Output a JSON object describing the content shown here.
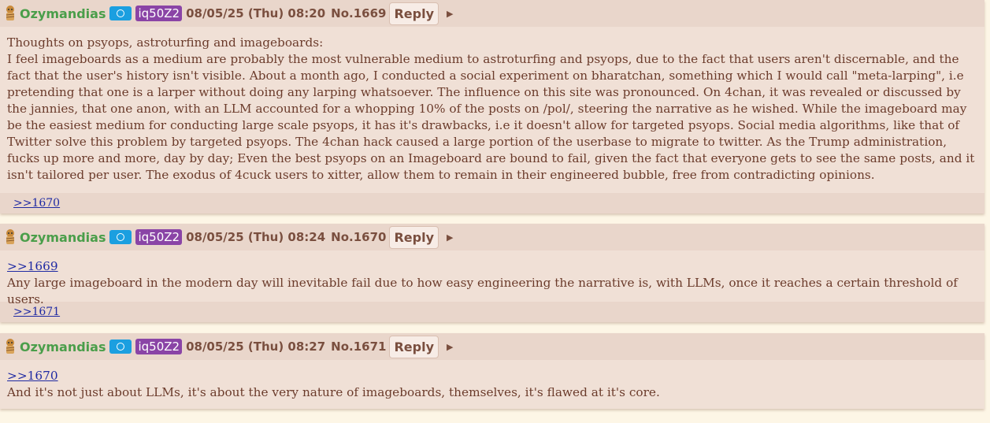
{
  "posts": [
    {
      "name": "Ozymandias",
      "id": "iq50Z2",
      "date": "08/05/25 (Thu) 08:20",
      "number": "No.1669",
      "reply_label": "Reply",
      "quote": "",
      "text": "Thoughts on psyops, astroturfing and imageboards:\nI feel imageboards as a medium are probably the most vulnerable medium to astroturfing and psyops, due to the fact that users aren't discernable, and the fact that the user's history isn't visible. About a month ago, I conducted a social experiment on bharatchan, something which I would call \"meta-larping\", i.e pretending that one is a larper without doing any larping whatsoever. The influence on this site was pronounced. On 4chan, it was revealed or discussed by the jannies, that one anon, with an LLM accounted for a whopping 10% of the posts on /pol/, steering the narrative as he wished. While the imageboard may be the easiest medium for conducting large scale psyops, it has it's drawbacks, i.e it doesn't allow for targeted psyops. Social media algorithms, like that of Twitter solve this problem by targeted psyops. The 4chan hack caused a large portion of the userbase to migrate to twitter. As the Trump administration, fucks up more and more, day by day; Even the best psyops on an Imageboard are bound to fail, given the fact that everyone gets to see the same posts, and it isn't tailored per user. The exodus of 4cuck users to xitter, allow them to remain in their engineered bubble, free from contradicting opinions.",
      "backlink": ">>1670"
    },
    {
      "name": "Ozymandias",
      "id": "iq50Z2",
      "date": "08/05/25 (Thu) 08:24",
      "number": "No.1670",
      "reply_label": "Reply",
      "quote": ">>1669",
      "text": "Any large imageboard in the modern day will inevitable fail due to how easy engineering the narrative is, with LLMs, once it reaches a certain threshold of users.",
      "backlink": ">>1671"
    },
    {
      "name": "Ozymandias",
      "id": "iq50Z2",
      "date": "08/05/25 (Thu) 08:27",
      "number": "No.1671",
      "reply_label": "Reply",
      "quote": ">>1670",
      "text": "And it's not just about LLMs, it's about the very nature of imageboards, themselves, it's flawed at it's core.",
      "backlink": ""
    }
  ],
  "colors": {
    "post_bg": "#f0e0d6",
    "header_bg": "#e9d6cb",
    "name": "#4a9e4a",
    "id_badge": "#8a44a6",
    "flag": "#1b9fe0",
    "link": "#1f2aa3"
  },
  "icons": {
    "avatar": "mummy-avatar-icon",
    "flag": "un-flag-icon",
    "menu": "triangle-right-icon"
  }
}
